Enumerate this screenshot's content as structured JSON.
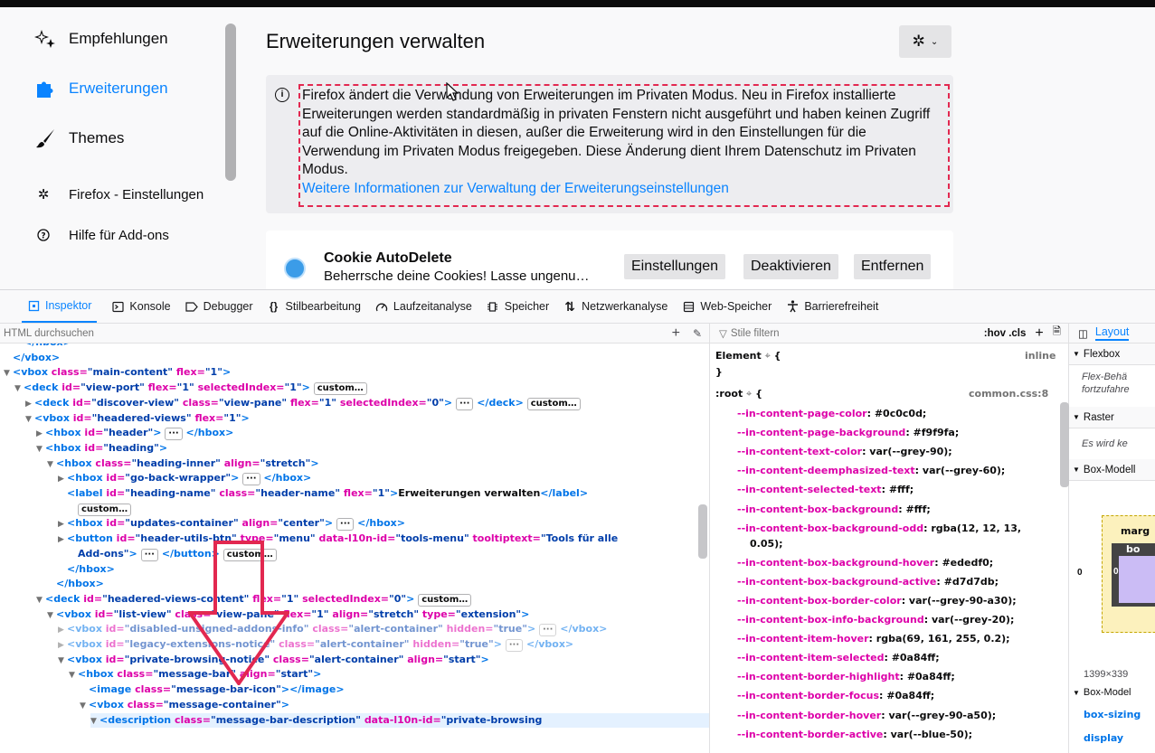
{
  "addons": {
    "categories": [
      {
        "label": "Empfehlungen"
      },
      {
        "label": "Erweiterungen"
      },
      {
        "label": "Themes"
      }
    ],
    "footer_items": [
      {
        "label": "Firefox - Einstellungen"
      },
      {
        "label": "Hilfe für Add-ons"
      }
    ],
    "title": "Erweiterungen verwalten",
    "notice": {
      "text": "Firefox ändert die Verwendung von Erweiterungen im Privaten Modus. Neu in Firefox installierte Erweiterungen werden standardmäßig in privaten Fenstern nicht ausgeführt und haben keinen Zugriff auf die Online-Aktivitäten in diesen, außer die Erweiterung wird in den Einstellungen für die Verwendung im Privaten Modus freigegeben. Diese Änderung dient Ihrem Datenschutz im Privaten Modus.",
      "link": "Weitere Informationen zur Verwaltung der Erweiterungseinstellungen"
    },
    "addon": {
      "name": "Cookie AutoDelete",
      "description": "Beherrsche deine Cookies! Lasse ungenu…",
      "btn_settings": "Einstellungen",
      "btn_disable": "Deaktivieren",
      "btn_remove": "Entfernen"
    }
  },
  "devtools": {
    "tabs": [
      {
        "label": "Inspektor",
        "icon": "inspector-icon"
      },
      {
        "label": "Konsole",
        "icon": "console-icon"
      },
      {
        "label": "Debugger",
        "icon": "debugger-icon"
      },
      {
        "label": "Stilbearbeitung",
        "icon": "style-editor-icon"
      },
      {
        "label": "Laufzeitanalyse",
        "icon": "performance-icon"
      },
      {
        "label": "Speicher",
        "icon": "memory-icon"
      },
      {
        "label": "Netzwerkanalyse",
        "icon": "network-icon"
      },
      {
        "label": "Web-Speicher",
        "icon": "storage-icon"
      },
      {
        "label": "Barrierefreiheit",
        "icon": "accessibility-icon"
      }
    ],
    "markup_search_placeholder": "HTML durchsuchen",
    "rules_filter_placeholder": "Stile filtern",
    "rules_toggles": ":hov .cls",
    "layout_tab": "Layout",
    "markup_lines": [
      {
        "indent": 5,
        "twisty": "",
        "html": "<span class='tg'>&lt;/hbox&gt;</span>"
      },
      {
        "indent": 4,
        "twisty": "",
        "html": "<span class='tg'>&lt;/vbox&gt;</span>"
      },
      {
        "indent": 4,
        "twisty": "▼",
        "html": "<span class='tg'>&lt;vbox</span> <span class='an'>class=</span><span class='av'>\"main-content\"</span> <span class='an'>flex=</span><span class='av'>\"1\"</span><span class='tg'>&gt;</span>"
      },
      {
        "indent": 5,
        "twisty": "▼",
        "html": "<span class='tg'>&lt;deck</span> <span class='an'>id=</span><span class='av'>\"view-port\"</span> <span class='an'>flex=</span><span class='av'>\"1\"</span> <span class='an'>selectedIndex=</span><span class='av'>\"1\"</span><span class='tg'>&gt;</span> <span class='badge'>custom…</span>"
      },
      {
        "indent": 6,
        "twisty": "▶",
        "html": "<span class='tg'>&lt;deck</span> <span class='an'>id=</span><span class='av'>\"discover-view\"</span> <span class='an'>class=</span><span class='av'>\"view-pane\"</span> <span class='an'>flex=</span><span class='av'>\"1\"</span> <span class='an'>selectedIndex=</span><span class='av'>\"0\"</span><span class='tg'>&gt;</span> <span class='badge'>···</span> <span class='tg'>&lt;/deck&gt;</span> <span class='badge'>custom…</span>"
      },
      {
        "indent": 6,
        "twisty": "▼",
        "html": "<span class='tg'>&lt;vbox</span> <span class='an'>id=</span><span class='av'>\"headered-views\"</span> <span class='an'>flex=</span><span class='av'>\"1\"</span><span class='tg'>&gt;</span>"
      },
      {
        "indent": 7,
        "twisty": "▶",
        "html": "<span class='tg'>&lt;hbox</span> <span class='an'>id=</span><span class='av'>\"header\"</span><span class='tg'>&gt;</span> <span class='badge'>···</span> <span class='tg'>&lt;/hbox&gt;</span>"
      },
      {
        "indent": 7,
        "twisty": "▼",
        "html": "<span class='tg'>&lt;hbox</span> <span class='an'>id=</span><span class='av'>\"heading\"</span><span class='tg'>&gt;</span>"
      },
      {
        "indent": 8,
        "twisty": "▼",
        "html": "<span class='tg'>&lt;hbox</span> <span class='an'>class=</span><span class='av'>\"heading-inner\"</span> <span class='an'>align=</span><span class='av'>\"stretch\"</span><span class='tg'>&gt;</span>"
      },
      {
        "indent": 9,
        "twisty": "▶",
        "html": "<span class='tg'>&lt;hbox</span> <span class='an'>id=</span><span class='av'>\"go-back-wrapper\"</span><span class='tg'>&gt;</span> <span class='badge'>···</span> <span class='tg'>&lt;/hbox&gt;</span>"
      },
      {
        "indent": 9,
        "twisty": "",
        "html": "<span class='tg'>&lt;label</span> <span class='an'>id=</span><span class='av'>\"heading-name\"</span> <span class='an'>class=</span><span class='av'>\"header-name\"</span> <span class='an'>flex=</span><span class='av'>\"1\"</span><span class='tg'>&gt;</span><span class='tx'>Erweiterungen verwalten</span><span class='tg'>&lt;/label&gt;</span>"
      },
      {
        "indent": 10,
        "twisty": "",
        "html": "<span class='badge'>custom…</span>"
      },
      {
        "indent": 9,
        "twisty": "▶",
        "html": "<span class='tg'>&lt;hbox</span> <span class='an'>id=</span><span class='av'>\"updates-container\"</span> <span class='an'>align=</span><span class='av'>\"center\"</span><span class='tg'>&gt;</span> <span class='badge'>···</span> <span class='tg'>&lt;/hbox&gt;</span>"
      },
      {
        "indent": 9,
        "twisty": "▶",
        "html": "<span class='tg'>&lt;button</span> <span class='an'>id=</span><span class='av'>\"header-utils-btn\"</span> <span class='an'>type=</span><span class='av'>\"menu\"</span> <span class='an'>data-l10n-id=</span><span class='av'>\"tools-menu\"</span> <span class='an'>tooltiptext=</span><span class='av'>\"Tools für alle</span>"
      },
      {
        "indent": 10,
        "twisty": "",
        "html": "<span class='av'>Add-ons\"</span><span class='tg'>&gt;</span> <span class='badge'>···</span> <span class='tg'>&lt;/button&gt;</span> <span class='badge'>custom…</span>"
      },
      {
        "indent": 9,
        "twisty": "",
        "html": "<span class='tg'>&lt;/hbox&gt;</span>"
      },
      {
        "indent": 8,
        "twisty": "",
        "html": "<span class='tg'>&lt;/hbox&gt;</span>"
      },
      {
        "indent": 7,
        "twisty": "▼",
        "html": "<span class='tg'>&lt;deck</span> <span class='an'>id=</span><span class='av'>\"headered-views-content\"</span> <span class='an'>flex=</span><span class='av'>\"1\"</span> <span class='an'>selectedIndex=</span><span class='av'>\"0\"</span><span class='tg'>&gt;</span> <span class='badge'>custom…</span>"
      },
      {
        "indent": 8,
        "twisty": "▼",
        "html": "<span class='tg'>&lt;vbox</span> <span class='an'>id=</span><span class='av'>\"list-view\"</span> <span class='an'>class=</span><span class='av'>\"view-pane\"</span> <span class='an'>flex=</span><span class='av'>\"1\"</span> <span class='an'>align=</span><span class='av'>\"stretch\"</span> <span class='an'>type=</span><span class='av'>\"extension\"</span><span class='tg'>&gt;</span>"
      },
      {
        "indent": 9,
        "twisty": "▶",
        "dim": true,
        "html": "<span class='tg'>&lt;vbox</span> <span class='an'>id=</span><span class='av'>\"disabled-unsigned-addons-info\"</span> <span class='an'>class=</span><span class='av'>\"alert-container\"</span> <span class='an'>hidden=</span><span class='av'>\"true\"</span><span class='tg'>&gt;</span> <span class='badge'>···</span> <span class='tg'>&lt;/vbox&gt;</span>"
      },
      {
        "indent": 9,
        "twisty": "▶",
        "dim": true,
        "html": "<span class='tg'>&lt;vbox</span> <span class='an'>id=</span><span class='av'>\"legacy-extensions-notice\"</span> <span class='an'>class=</span><span class='av'>\"alert-container\"</span> <span class='an'>hidden=</span><span class='av'>\"true\"</span><span class='tg'>&gt;</span> <span class='badge'>···</span> <span class='tg'>&lt;/vbox&gt;</span>"
      },
      {
        "indent": 9,
        "twisty": "▼",
        "html": "<span class='tg'>&lt;vbox</span> <span class='an'>id=</span><span class='av'>\"private-browsing-notice\"</span> <span class='an'>class=</span><span class='av'>\"alert-container\"</span> <span class='an'>align=</span><span class='av'>\"start\"</span><span class='tg'>&gt;</span>"
      },
      {
        "indent": 10,
        "twisty": "▼",
        "html": "<span class='tg'>&lt;hbox</span> <span class='an'>class=</span><span class='av'>\"message-bar\"</span> <span class='an'>align=</span><span class='av'>\"start\"</span><span class='tg'>&gt;</span>"
      },
      {
        "indent": 11,
        "twisty": "",
        "html": "<span class='tg'>&lt;image</span> <span class='an'>class=</span><span class='av'>\"message-bar-icon\"</span><span class='tg'>&gt;&lt;/image&gt;</span>"
      },
      {
        "indent": 11,
        "twisty": "▼",
        "html": "<span class='tg'>&lt;vbox</span> <span class='an'>class=</span><span class='av'>\"message-container\"</span><span class='tg'>&gt;</span>"
      },
      {
        "indent": 12,
        "twisty": "▼",
        "html": "<span class='tg'>&lt;description</span> <span class='an'>class=</span><span class='av'>\"message-bar-description\"</span> <span class='an'>data-l10n-id=</span><span class='av'>\"private-browsing</span>"
      }
    ],
    "rules": {
      "element_selector": "Element",
      "element_source": "inline",
      "root_selector": ":root",
      "root_source": "common.css:8",
      "declarations": [
        {
          "name": "--in-content-page-color",
          "value": "#0c0c0d;"
        },
        {
          "name": "--in-content-page-background",
          "value": "#f9f9fa;"
        },
        {
          "name": "--in-content-text-color",
          "value": "var(--grey-90);"
        },
        {
          "name": "--in-content-deemphasized-text",
          "value": "var(--grey-60);"
        },
        {
          "name": "--in-content-selected-text",
          "value": "#fff;"
        },
        {
          "name": "--in-content-box-background",
          "value": "#fff;"
        },
        {
          "name": "--in-content-box-background-odd",
          "value": "rgba(12, 12, 13,",
          "cont": "0.05);"
        },
        {
          "name": "--in-content-box-background-hover",
          "value": "#ededf0;"
        },
        {
          "name": "--in-content-box-background-active",
          "value": "#d7d7db;"
        },
        {
          "name": "--in-content-box-border-color",
          "value": "var(--grey-90-a30);"
        },
        {
          "name": "--in-content-box-info-background",
          "value": "var(--grey-20);"
        },
        {
          "name": "--in-content-item-hover",
          "value": "rgba(69, 161, 255, 0.2);"
        },
        {
          "name": "--in-content-item-selected",
          "value": "#0a84ff;"
        },
        {
          "name": "--in-content-border-highlight",
          "value": "#0a84ff;"
        },
        {
          "name": "--in-content-border-focus",
          "value": "#0a84ff;"
        },
        {
          "name": "--in-content-border-hover",
          "value": "var(--grey-90-a50);"
        },
        {
          "name": "--in-content-border-active",
          "value": "var(--blue-50);"
        }
      ]
    },
    "layout": {
      "flexbox_label": "Flexbox",
      "flexbox_note": "Flex-Behä",
      "flexbox_note2": "fortzufahre",
      "grid_label": "Raster",
      "grid_note": "Es wird ke",
      "boxmodel_label": "Box-Modell",
      "margin_label": "marg",
      "border_label": "bo",
      "margin_left": "0",
      "border_left": "0",
      "dimensions": "1399×339",
      "boxmodel_props_label": "Box-Model",
      "prop1": "box-sizing",
      "prop2": "display"
    }
  }
}
